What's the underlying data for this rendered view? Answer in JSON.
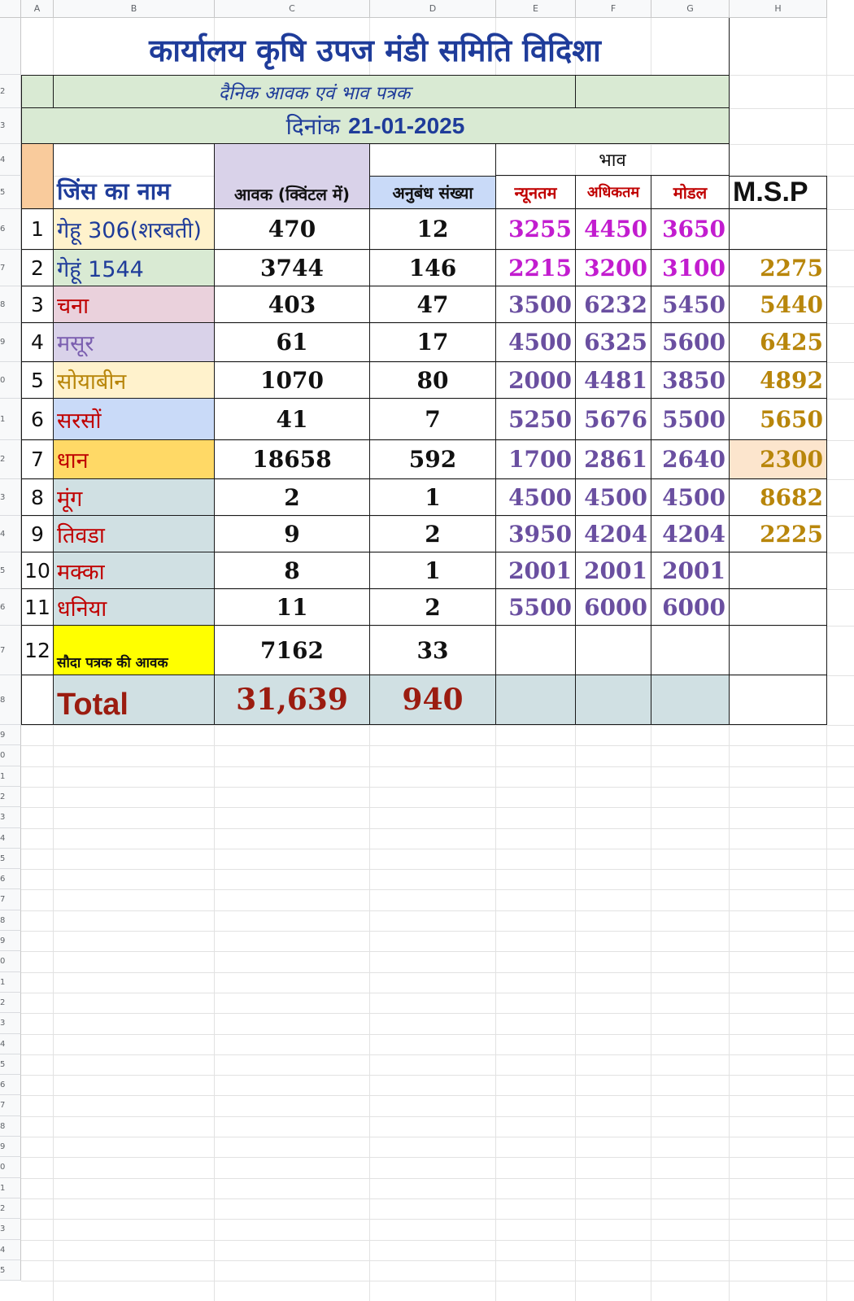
{
  "colors": {
    "header_blue": "#1f3c9a",
    "header_green": "#d9ead3",
    "peach": "#f9cb9c",
    "lavender": "#d9d2e9",
    "light_blue": "#c9daf8",
    "yellow_name": "#fff2cc",
    "green_name": "#d9ead3",
    "pink_name": "#ead1dc",
    "orange_name": "#ffd966",
    "grey_name": "#d0e0e3",
    "bright_yellow": "#ffff00",
    "magenta_text": "#c21ccf",
    "purple_text": "#6a4fa0",
    "gold_text": "#b8860b",
    "red_text": "#c00000",
    "total_red": "#9b1c10"
  },
  "column_headers": [
    "A",
    "B",
    "C",
    "D",
    "E",
    "F",
    "G",
    "H"
  ],
  "row_numbers": [
    "",
    "2",
    "3",
    "4",
    "5",
    "6",
    "7",
    "8",
    "9",
    "0",
    "1",
    "2",
    "3",
    "4",
    "5",
    "6",
    "7",
    "8",
    "9",
    "0",
    "1",
    "2",
    "3",
    "4",
    "5",
    "6",
    "7",
    "8",
    "9",
    "0",
    "1",
    "2",
    "3",
    "4",
    "5",
    "6",
    "7",
    "8",
    "9",
    "0",
    "1",
    "2",
    "3",
    "4",
    "5",
    "6",
    "7",
    "8",
    "9",
    "0",
    "1",
    "2",
    "3",
    "4",
    "5",
    "6"
  ],
  "title": "कार्यालय कृषि उपज मंडी समिति विदिशा",
  "subtitle": "दैनिक आवक एवं भाव पत्रक",
  "date_label": "दिनांक",
  "date_value": "21-01-2025",
  "headers": {
    "name": "जिंस का नाम",
    "arrival": "आवक (क्विंटल में)",
    "contracts": "अनुबंध संख्या",
    "price_group": "भाव",
    "min": "न्यूनतम",
    "max": "अधिकतम",
    "modal": "मोडल",
    "msp": "M.S.P"
  },
  "rows": [
    {
      "sn": "1",
      "name": "गेहू 306(शरबती)",
      "arrival": "470",
      "contracts": "12",
      "min": "3255",
      "max": "4450",
      "modal": "3650",
      "msp": ""
    },
    {
      "sn": "2",
      "name": "गेहूं 1544",
      "arrival": "3744",
      "contracts": "146",
      "min": "2215",
      "max": "3200",
      "modal": "3100",
      "msp": "2275"
    },
    {
      "sn": "3",
      "name": "चना",
      "arrival": "403",
      "contracts": "47",
      "min": "3500",
      "max": "6232",
      "modal": "5450",
      "msp": "5440"
    },
    {
      "sn": "4",
      "name": "मसूर",
      "arrival": "61",
      "contracts": "17",
      "min": "4500",
      "max": "6325",
      "modal": "5600",
      "msp": "6425"
    },
    {
      "sn": "5",
      "name": "सोयाबीन",
      "arrival": "1070",
      "contracts": "80",
      "min": "2000",
      "max": "4481",
      "modal": "3850",
      "msp": "4892"
    },
    {
      "sn": "6",
      "name": "सरसों",
      "arrival": "41",
      "contracts": "7",
      "min": "5250",
      "max": "5676",
      "modal": "5500",
      "msp": "5650"
    },
    {
      "sn": "7",
      "name": "धान",
      "arrival": "18658",
      "contracts": "592",
      "min": "1700",
      "max": "2861",
      "modal": "2640",
      "msp": "2300"
    },
    {
      "sn": "8",
      "name": "मूंग",
      "arrival": "2",
      "contracts": "1",
      "min": "4500",
      "max": "4500",
      "modal": "4500",
      "msp": "8682"
    },
    {
      "sn": "9",
      "name": "तिवडा",
      "arrival": "9",
      "contracts": "2",
      "min": "3950",
      "max": "4204",
      "modal": "4204",
      "msp": "2225"
    },
    {
      "sn": "10",
      "name": "मक्का",
      "arrival": "8",
      "contracts": "1",
      "min": "2001",
      "max": "2001",
      "modal": "2001",
      "msp": ""
    },
    {
      "sn": "11",
      "name": "धनिया",
      "arrival": "11",
      "contracts": "2",
      "min": "5500",
      "max": "6000",
      "modal": "6000",
      "msp": ""
    },
    {
      "sn": "12",
      "name": "सौदा पत्रक की आवक",
      "arrival": "7162",
      "contracts": "33",
      "min": "",
      "max": "",
      "modal": "",
      "msp": ""
    }
  ],
  "total": {
    "label": "Total",
    "arrival": "31,639",
    "contracts": "940"
  }
}
